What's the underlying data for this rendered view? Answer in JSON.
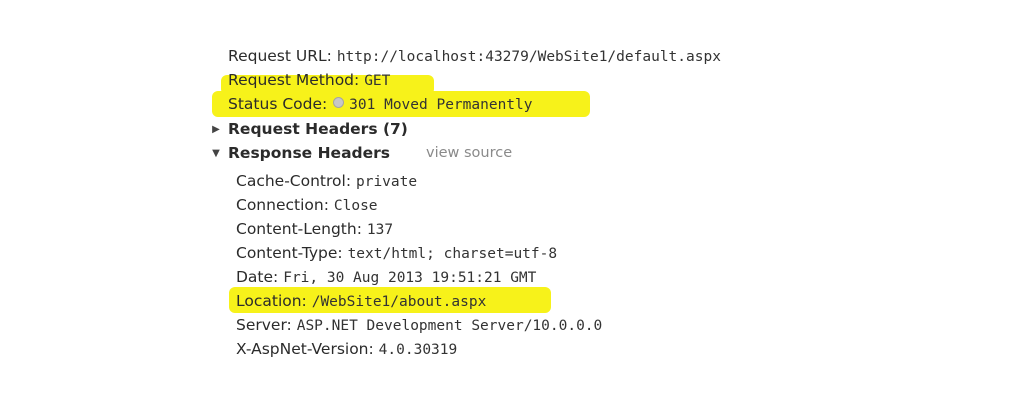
{
  "general": {
    "request_url_label": "Request URL:",
    "request_url_value": "http://localhost:43279/WebSite1/default.aspx",
    "request_method_label": "Request Method:",
    "request_method_value": "GET",
    "status_code_label": "Status Code:",
    "status_code_value": "301 Moved Permanently"
  },
  "sections": {
    "request_headers": {
      "label": "Request Headers (7)",
      "expanded": false
    },
    "response_headers": {
      "label": "Response Headers",
      "expanded": true,
      "view_source_label": "view source"
    }
  },
  "response_headers": {
    "cache_control_label": "Cache-Control:",
    "cache_control_value": "private",
    "connection_label": "Connection:",
    "connection_value": "Close",
    "content_length_label": "Content-Length:",
    "content_length_value": "137",
    "content_type_label": "Content-Type:",
    "content_type_value": "text/html; charset=utf-8",
    "date_label": "Date:",
    "date_value": "Fri, 30 Aug 2013 19:51:21 GMT",
    "location_label": "Location:",
    "location_value": "/WebSite1/about.aspx",
    "server_label": "Server:",
    "server_value": "ASP.NET Development Server/10.0.0.0",
    "x_aspnet_version_label": "X-AspNet-Version:",
    "x_aspnet_version_value": "4.0.30319"
  },
  "icons": {
    "collapsed_triangle": "triangle-right-icon",
    "expanded_triangle": "triangle-down-icon",
    "status_indicator": "status-dot-icon"
  },
  "colors": {
    "highlight": "#f7f21a",
    "text": "#2b2b2b",
    "muted": "#8a8a8a"
  }
}
